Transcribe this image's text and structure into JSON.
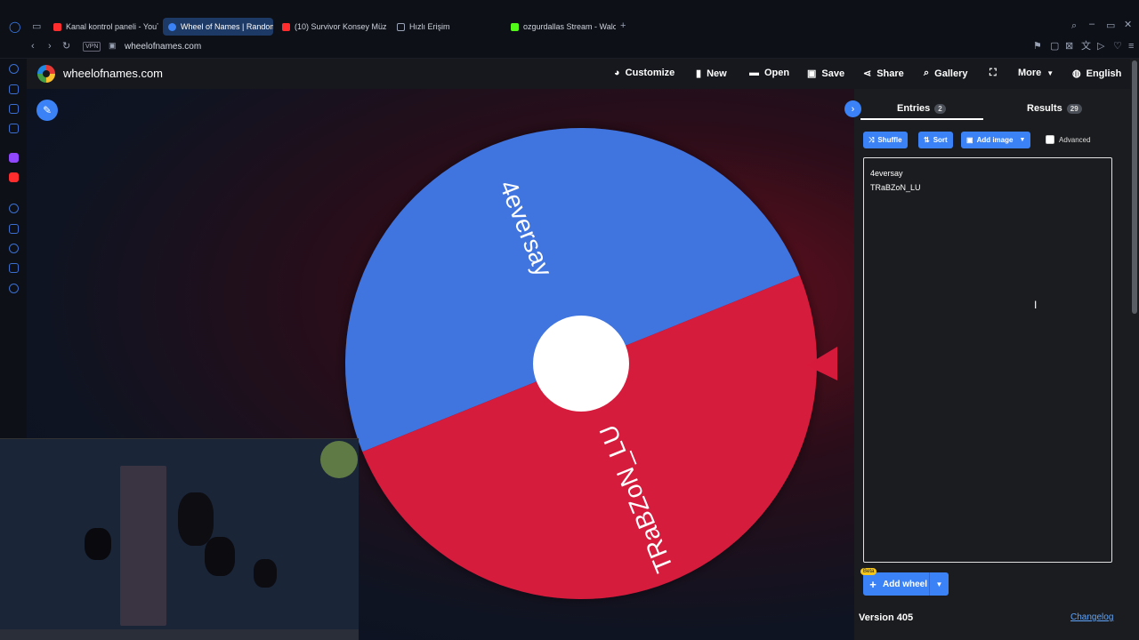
{
  "browser": {
    "tabs": [
      {
        "label": "Kanal kontrol paneli - YouT",
        "icon": "youtube-icon",
        "color": "#ff2d2d"
      },
      {
        "label": "Wheel of Names | Random",
        "icon": "wheel-icon",
        "color": "#3b82f6",
        "active": true
      },
      {
        "label": "(10) Survivor Konsey Müz",
        "icon": "youtube-icon",
        "color": "#ff2d2d"
      },
      {
        "label": "Hızlı Erişim",
        "icon": "grid-icon",
        "color": "#9aa3b5"
      },
      {
        "label": "ozgurdallas Stream - Walc",
        "icon": "kick-icon",
        "color": "#53fc18"
      }
    ],
    "vpn_label": "VPN",
    "url": "wheelofnames.com"
  },
  "site": {
    "title": "wheelofnames.com",
    "nav": {
      "customize": "Customize",
      "new": "New",
      "open": "Open",
      "save": "Save",
      "share": "Share",
      "gallery": "Gallery",
      "more": "More",
      "language": "English"
    }
  },
  "wheel": {
    "segments": [
      {
        "label": "4eversay",
        "color": "#3f74e0"
      },
      {
        "label": "TRaBZoN_LU",
        "color": "#d61a3c"
      }
    ],
    "hub_color": "#ffffff",
    "pointer_color": "#d61a3c"
  },
  "panel": {
    "tabs": {
      "entries_label": "Entries",
      "entries_count": "2",
      "results_label": "Results",
      "results_count": "29"
    },
    "tools": {
      "shuffle": "Shuffle",
      "sort": "Sort",
      "add_image": "Add image",
      "advanced": "Advanced"
    },
    "entries": [
      "4eversay",
      "TRaBZoN_LU"
    ],
    "add_wheel": "Add wheel",
    "beta": "Beta",
    "version": "Version 405",
    "changelog": "Changelog"
  }
}
